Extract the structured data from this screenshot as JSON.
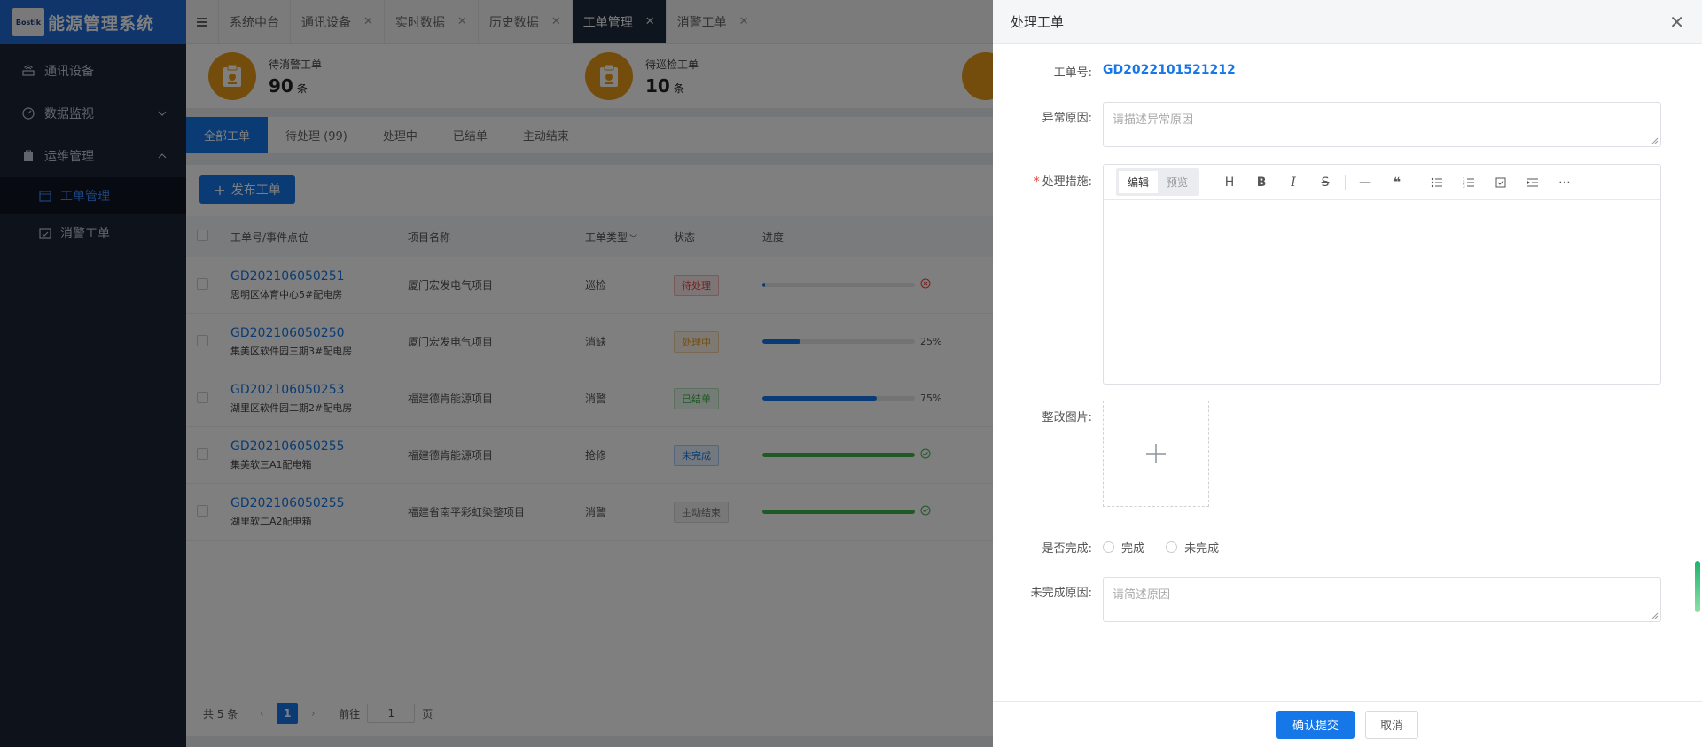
{
  "app": {
    "logo_text": "Bostik",
    "title": "能源管理系统"
  },
  "sidebar": {
    "items": [
      {
        "label": "通讯设备"
      },
      {
        "label": "数据监视"
      },
      {
        "label": "运维管理"
      }
    ],
    "subitems": [
      {
        "label": "工单管理"
      },
      {
        "label": "消警工单"
      }
    ]
  },
  "top_tabs": [
    {
      "label": "系统中台"
    },
    {
      "label": "通讯设备"
    },
    {
      "label": "实时数据"
    },
    {
      "label": "历史数据"
    },
    {
      "label": "工单管理"
    },
    {
      "label": "消警工单"
    }
  ],
  "stats": [
    {
      "label": "待消警工单",
      "value": "90",
      "unit": "条"
    },
    {
      "label": "待巡检工单",
      "value": "10",
      "unit": "条"
    }
  ],
  "filter_tabs": [
    {
      "label": "全部工单"
    },
    {
      "label": "待处理 (99)"
    },
    {
      "label": "处理中"
    },
    {
      "label": "已结单"
    },
    {
      "label": "主动结束"
    }
  ],
  "publish_label": "发布工单",
  "table": {
    "headers": {
      "no": "工单号/事件点位",
      "project": "项目名称",
      "type": "工单类型",
      "status": "状态",
      "progress": "进度"
    },
    "rows": [
      {
        "no": "GD202106050251",
        "loc": "思明区体育中心5#配电房",
        "project": "厦门宏发电气项目",
        "type": "巡检",
        "status": "待处理",
        "progress": 0.02,
        "end": ""
      },
      {
        "no": "GD202106050250",
        "loc": "集美区软件园三期3#配电房",
        "project": "厦门宏发电气项目",
        "type": "消缺",
        "status": "处理中",
        "progress": 0.25,
        "end": "25%"
      },
      {
        "no": "GD202106050253",
        "loc": "湖里区软件园二期2#配电房",
        "project": "福建德肯能源项目",
        "type": "消警",
        "status": "已结单",
        "progress": 0.75,
        "end": "75%"
      },
      {
        "no": "GD202106050255",
        "loc": "集美软三A1配电箱",
        "project": "福建德肯能源项目",
        "type": "抢修",
        "status": "未完成",
        "progress": 1.0,
        "end": ""
      },
      {
        "no": "GD202106050255",
        "loc": "湖里软二A2配电箱",
        "project": "福建省南平彩虹染整项目",
        "type": "消警",
        "status": "主动结束",
        "progress": 1.0,
        "end": ""
      }
    ]
  },
  "pager": {
    "total": "共 5 条",
    "current": "1",
    "goto": "前往",
    "goto_value": "1",
    "page_unit": "页"
  },
  "drawer": {
    "title": "处理工单",
    "wo_label": "工单号:",
    "wo_value": "GD2022101521212",
    "reason_label": "异常原因:",
    "reason_placeholder": "请描述异常原因",
    "measure_label": "处理措施:",
    "editor_tabs": [
      "编辑",
      "预览"
    ],
    "image_label": "整改图片:",
    "complete_label": "是否完成:",
    "complete_options": [
      "完成",
      "未完成"
    ],
    "unfinished_label": "未完成原因:",
    "unfinished_placeholder": "请简述原因",
    "submit_label": "确认提交",
    "cancel_label": "取消"
  },
  "colors": {
    "accent": "#1677e8",
    "sidebar": "#1b2537",
    "danger": "#e64340",
    "success": "#3fb24a",
    "warning": "#e89b1a"
  }
}
